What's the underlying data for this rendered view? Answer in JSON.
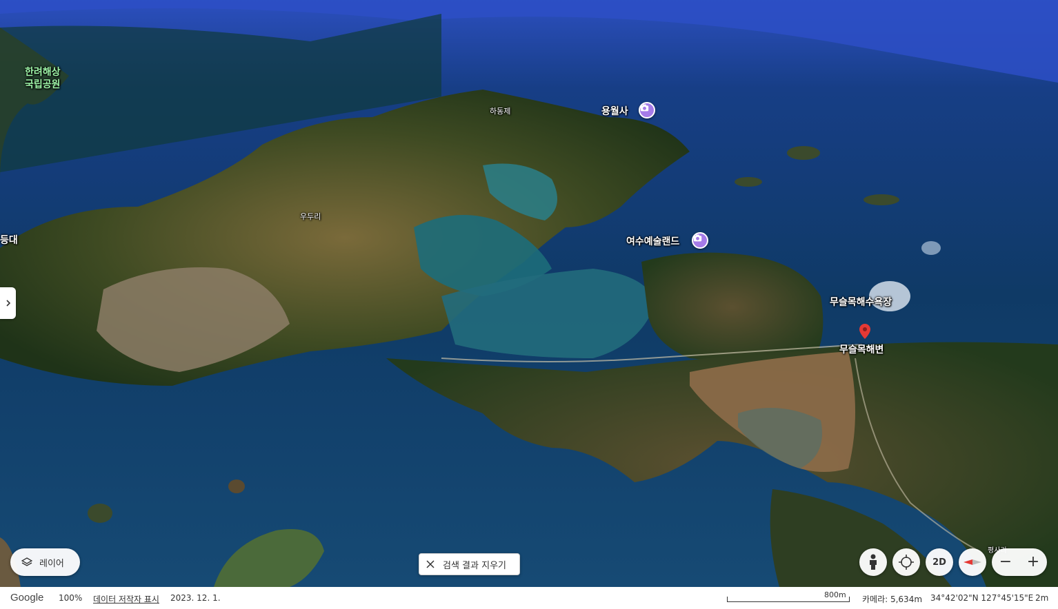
{
  "map": {
    "labels": {
      "hallyeo": "한려해상\n국립공원",
      "hadongje": "하동제",
      "yongwolsa": "용월사",
      "udu_ri": "우두리",
      "deungdae": "등대",
      "yeosu_artland": "여수예술랜드",
      "museulmok_beach_resort": "무슬목해수욕장",
      "museulmok_beach": "무슬목해변",
      "pyeongsa_ri": "평사리"
    },
    "poi_icon": "camera-icon",
    "poi_color": "#a57be8",
    "pin_color": "#e53935"
  },
  "controls": {
    "layers_label": "레이어",
    "clear_search_label": "검색 결과 지우기",
    "view_2d_label": "2D",
    "zoom_out": "−",
    "zoom_in": "+"
  },
  "footer": {
    "logo": "Google",
    "zoom": "100%",
    "attribution": "데이터 저작자 표시",
    "date": "2023. 12. 1.",
    "scale": "800m",
    "camera": "카메라: 5,634m",
    "coords": "34°42'02\"N 127°45'15\"E",
    "alt": "2m"
  }
}
